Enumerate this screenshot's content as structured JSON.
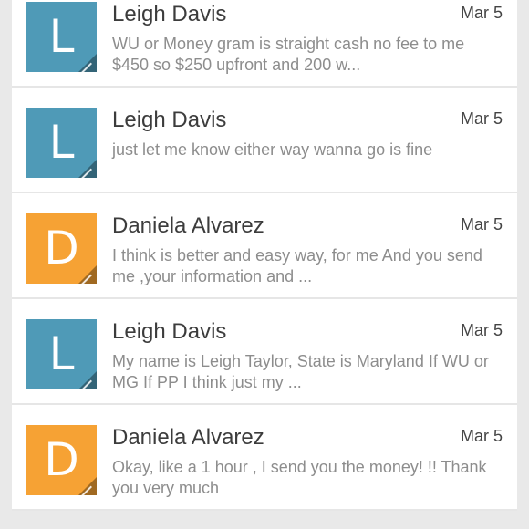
{
  "colors": {
    "avatar_blue": "#4f9ab7",
    "avatar_orange": "#f6a234"
  },
  "messages": [
    {
      "initial": "L",
      "avatar_color": "blue",
      "sender": "Leigh Davis",
      "date": "Mar 5",
      "snippet": "WU or Money gram is straight cash no fee to me $450 so $250 upfront and 200 w..."
    },
    {
      "initial": "L",
      "avatar_color": "blue",
      "sender": "Leigh Davis",
      "date": "Mar 5",
      "snippet": "just let me know either way wanna go is fine"
    },
    {
      "initial": "D",
      "avatar_color": "orange",
      "sender": "Daniela Alvarez",
      "date": "Mar 5",
      "snippet": "I think is better and easy way, for me And you send me ,your information and ..."
    },
    {
      "initial": "L",
      "avatar_color": "blue",
      "sender": "Leigh Davis",
      "date": "Mar 5",
      "snippet": "My name is Leigh Taylor, State is Maryland If WU or MG If PP I think just my ..."
    },
    {
      "initial": "D",
      "avatar_color": "orange",
      "sender": "Daniela Alvarez",
      "date": "Mar 5",
      "snippet": "Okay, like a 1 hour , I send you the money! !! Thank you very much"
    }
  ]
}
